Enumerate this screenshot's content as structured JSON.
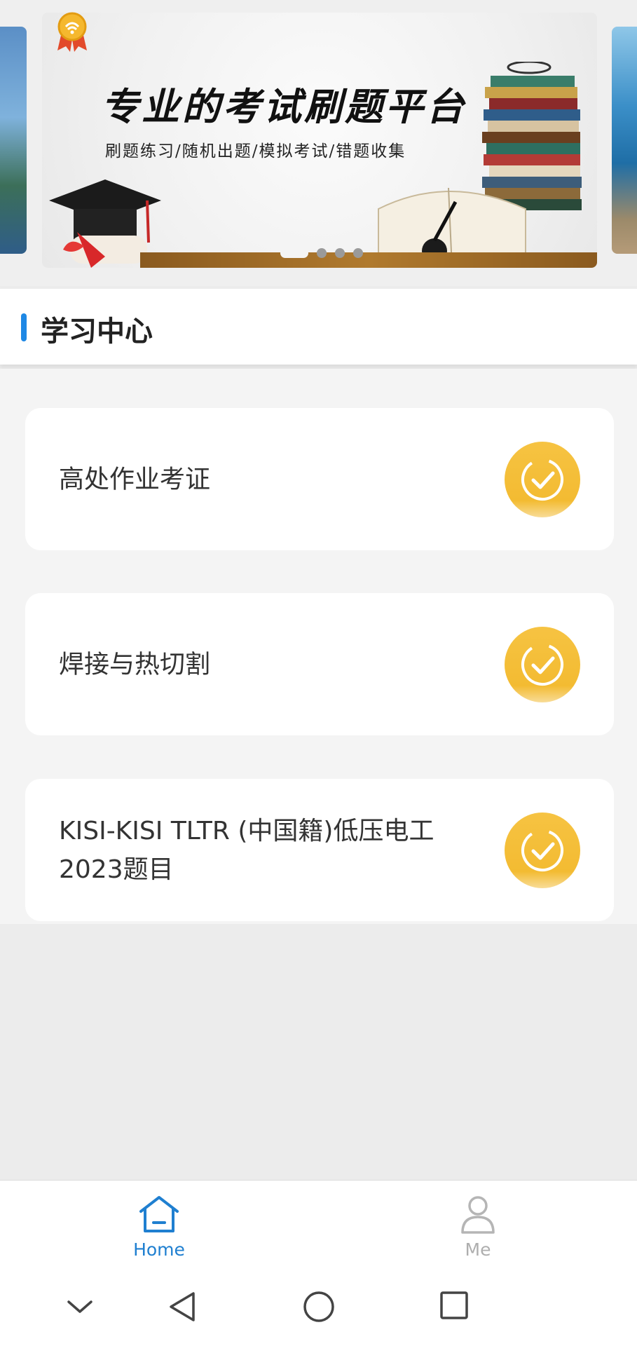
{
  "banner": {
    "title": "专业的考试刷题平台",
    "subtitle": "刷题练习/随机出题/模拟考试/错题收集",
    "dots_total": 4,
    "active_dot": 0
  },
  "section": {
    "title": "学习中心"
  },
  "courses": [
    {
      "label": "高处作业考证",
      "icon": "check-circle-icon"
    },
    {
      "label": "焊接与热切割",
      "icon": "check-circle-icon"
    },
    {
      "label": "KISI-KISI TLTR (中国籍)低压电工2023题目",
      "icon": "check-circle-icon"
    }
  ],
  "bottom_nav": {
    "items": [
      {
        "label": "Home",
        "icon": "home-icon",
        "active": true
      },
      {
        "label": "Me",
        "icon": "person-icon",
        "active": false
      }
    ]
  },
  "system_nav": {
    "buttons": [
      "hide-keyboard-icon",
      "back-icon",
      "home-circle-icon",
      "recents-icon"
    ]
  },
  "colors": {
    "accent_blue": "#1f7fd0",
    "badge_yellow": "#f3bb32",
    "page_bg": "#f4f4f4"
  }
}
